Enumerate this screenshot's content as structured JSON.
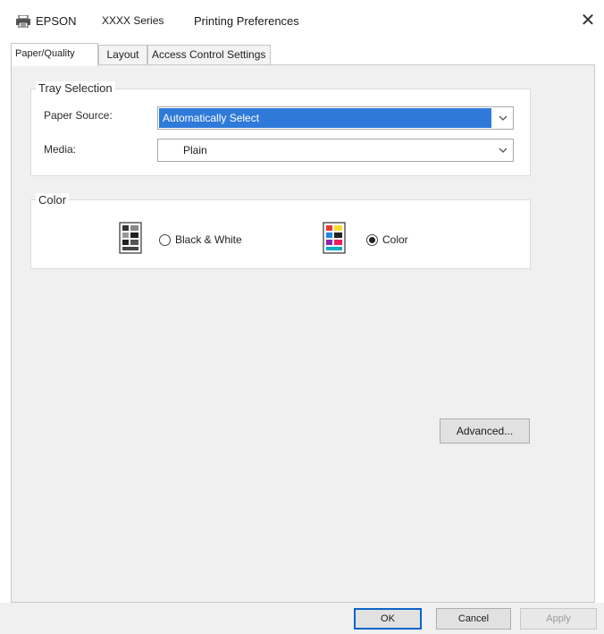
{
  "window": {
    "brand": "EPSON",
    "series": "XXXX Series",
    "title": "Printing Preferences",
    "close_glyph": "✕"
  },
  "tabs": [
    {
      "label": "Paper/Quality",
      "active": true
    },
    {
      "label": "Layout",
      "active": false
    },
    {
      "label": "Access Control Settings",
      "active": false
    }
  ],
  "tray_selection": {
    "title": "Tray Selection",
    "paper_source_label": "Paper Source:",
    "paper_source_value": "Automatically Select",
    "media_label": "Media:",
    "media_value": "Plain"
  },
  "color": {
    "title": "Color",
    "options": [
      {
        "label": "Black & White",
        "selected": false,
        "icon": "bw-document-icon"
      },
      {
        "label": "Color",
        "selected": true,
        "icon": "color-document-icon"
      }
    ]
  },
  "buttons": {
    "advanced": "Advanced...",
    "ok": "OK",
    "cancel": "Cancel",
    "apply": "Apply"
  },
  "colors": {
    "selection": "#2f7ad9",
    "panel": "#f0f0f0",
    "default_button_border": "#0a64c8"
  }
}
